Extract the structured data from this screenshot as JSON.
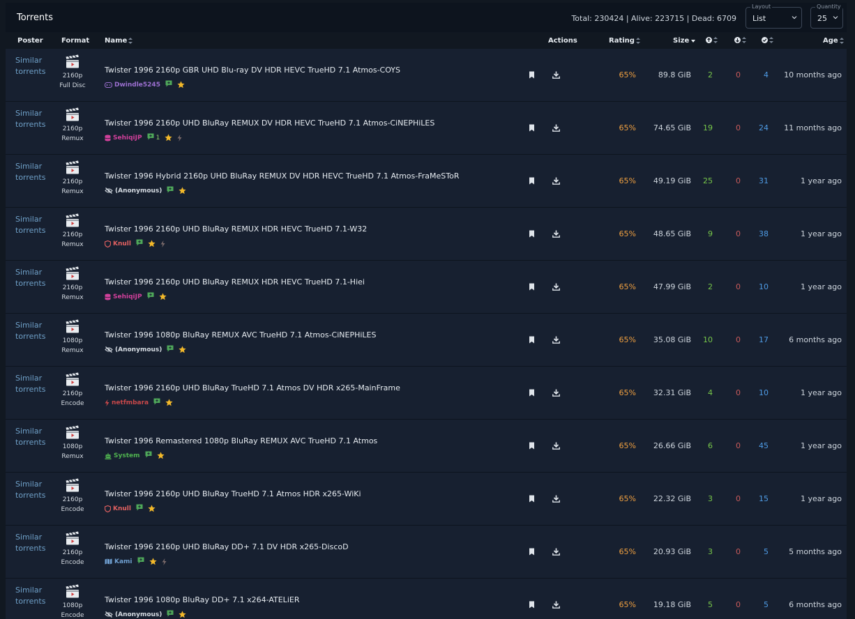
{
  "header": {
    "title": "Torrents",
    "stats": "Total: 230424 | Alive: 223715 | Dead: 6709",
    "layout": {
      "legend": "Layout",
      "value": "List"
    },
    "quantity": {
      "legend": "Quantity",
      "value": "25"
    }
  },
  "columns": {
    "poster": "Poster",
    "format": "Format",
    "name": "Name",
    "actions": "Actions",
    "rating": "Rating",
    "size": "Size",
    "age": "Age"
  },
  "colors": {
    "seeders": "#78c84a",
    "leechers": "#c85a5a",
    "completed": "#4f9ce6",
    "rating": "#f0a040",
    "link": "#6fa0c8"
  },
  "rows": [
    {
      "similar": "Similar torrents",
      "res": "2160p",
      "type": "Full Disc",
      "name": "Twister 1996 2160p GBR UHD Blu-ray DV HDR HEVC TrueHD 7.1 Atmos-COYS",
      "uploader": "Dwindle5245",
      "uploader_icon": "gamepad-icon",
      "uploader_color": "#9b6fd0",
      "comments": "",
      "featured": false,
      "rating": "65%",
      "size": "89.8 GiB",
      "seeders": "2",
      "leechers": "0",
      "completed": "4",
      "age": "10 months ago"
    },
    {
      "similar": "Similar torrents",
      "res": "2160p",
      "type": "Remux",
      "name": "Twister 1996 2160p UHD BluRay REMUX DV HDR HEVC TrueHD 7.1 Atmos-CiNEPHiLES",
      "uploader": "SehiqiJP",
      "uploader_icon": "database-icon",
      "uploader_color": "#d0409a",
      "comments": "1",
      "featured": true,
      "rating": "65%",
      "size": "74.65 GiB",
      "seeders": "19",
      "leechers": "0",
      "completed": "24",
      "age": "11 months ago"
    },
    {
      "similar": "Similar torrents",
      "res": "2160p",
      "type": "Remux",
      "name": "Twister 1996 Hybrid 2160p UHD BluRay REMUX DV HDR HEVC TrueHD 7.1 Atmos-FraMeSToR",
      "uploader": "(Anonymous)",
      "uploader_icon": "eye-slash-icon",
      "uploader_color": "#d6dce3",
      "comments": "",
      "featured": false,
      "rating": "65%",
      "size": "49.19 GiB",
      "seeders": "25",
      "leechers": "0",
      "completed": "31",
      "age": "1 year ago"
    },
    {
      "similar": "Similar torrents",
      "res": "2160p",
      "type": "Remux",
      "name": "Twister 1996 2160p UHD BluRay REMUX HDR HEVC TrueHD 7.1-W32",
      "uploader": "Knull",
      "uploader_icon": "shield-icon",
      "uploader_color": "#e06060",
      "comments": "",
      "featured": true,
      "rating": "65%",
      "size": "48.65 GiB",
      "seeders": "9",
      "leechers": "0",
      "completed": "38",
      "age": "1 year ago"
    },
    {
      "similar": "Similar torrents",
      "res": "2160p",
      "type": "Remux",
      "name": "Twister 1996 2160p UHD BluRay REMUX HDR HEVC TrueHD 7.1-Hiei",
      "uploader": "SehiqiJP",
      "uploader_icon": "database-icon",
      "uploader_color": "#d0409a",
      "comments": "",
      "featured": false,
      "rating": "65%",
      "size": "47.99 GiB",
      "seeders": "2",
      "leechers": "0",
      "completed": "10",
      "age": "1 year ago"
    },
    {
      "similar": "Similar torrents",
      "res": "1080p",
      "type": "Remux",
      "name": "Twister 1996 1080p BluRay REMUX AVC TrueHD 7.1 Atmos-CiNEPHiLES",
      "uploader": "(Anonymous)",
      "uploader_icon": "eye-slash-icon",
      "uploader_color": "#d6dce3",
      "comments": "",
      "featured": false,
      "rating": "65%",
      "size": "35.08 GiB",
      "seeders": "10",
      "leechers": "0",
      "completed": "17",
      "age": "6 months ago"
    },
    {
      "similar": "Similar torrents",
      "res": "2160p",
      "type": "Encode",
      "name": "Twister 1996 2160p UHD BluRay TrueHD 7.1 Atmos DV HDR x265-MainFrame",
      "uploader": "netfmbara",
      "uploader_icon": "bolt-icon",
      "uploader_color": "#c8484a",
      "comments": "",
      "featured": false,
      "rating": "65%",
      "size": "32.31 GiB",
      "seeders": "4",
      "leechers": "0",
      "completed": "10",
      "age": "1 year ago"
    },
    {
      "similar": "Similar torrents",
      "res": "1080p",
      "type": "Remux",
      "name": "Twister 1996 Remastered 1080p BluRay REMUX AVC TrueHD 7.1 Atmos",
      "uploader": "System",
      "uploader_icon": "robot-icon",
      "uploader_color": "#4fb24f",
      "comments": "",
      "featured": false,
      "rating": "65%",
      "size": "26.66 GiB",
      "seeders": "6",
      "leechers": "0",
      "completed": "45",
      "age": "1 year ago"
    },
    {
      "similar": "Similar torrents",
      "res": "2160p",
      "type": "Encode",
      "name": "Twister 1996 2160p UHD BluRay TrueHD 7.1 Atmos HDR x265-WiKi",
      "uploader": "Knull",
      "uploader_icon": "shield-icon",
      "uploader_color": "#e06060",
      "comments": "",
      "featured": false,
      "rating": "65%",
      "size": "22.32 GiB",
      "seeders": "3",
      "leechers": "0",
      "completed": "15",
      "age": "1 year ago"
    },
    {
      "similar": "Similar torrents",
      "res": "2160p",
      "type": "Encode",
      "name": "Twister 1996 2160p UHD BluRay DD+ 7.1 DV HDR x265-DiscoD",
      "uploader": "Kami",
      "uploader_icon": "map-icon",
      "uploader_color": "#6f9fd0",
      "comments": "",
      "featured": true,
      "rating": "65%",
      "size": "20.93 GiB",
      "seeders": "3",
      "leechers": "0",
      "completed": "5",
      "age": "5 months ago"
    },
    {
      "similar": "Similar torrents",
      "res": "1080p",
      "type": "Encode",
      "name": "Twister 1996 1080p BluRay DD+ 7.1 x264-ATELiER",
      "uploader": "(Anonymous)",
      "uploader_icon": "eye-slash-icon",
      "uploader_color": "#d6dce3",
      "comments": "",
      "featured": false,
      "rating": "65%",
      "size": "19.18 GiB",
      "seeders": "5",
      "leechers": "0",
      "completed": "5",
      "age": "6 months ago"
    }
  ]
}
